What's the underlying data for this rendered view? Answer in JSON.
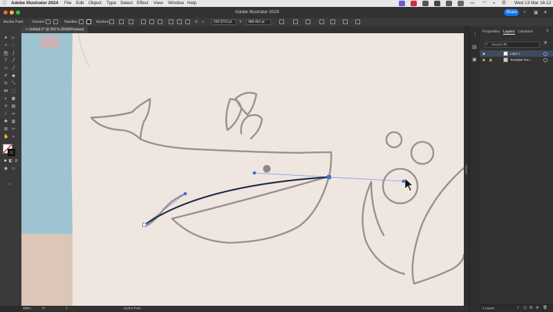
{
  "menubar": {
    "app_name": "Adobe Illustrator 2024",
    "menus": [
      "File",
      "Edit",
      "Object",
      "Type",
      "Select",
      "Effect",
      "View",
      "Window",
      "Help"
    ],
    "clock": "Wed 13 Mar  16:12"
  },
  "titlebar": {
    "title": "Adobe Illustrator 2024",
    "share_label": "Share"
  },
  "controlbar": {
    "anchor_point_label": "Anchor Point",
    "convert_label": "Convert:",
    "handles_label": "Handles:",
    "anchors_label": "Anchors:",
    "x_value": "530.9753 pt",
    "y_value": "488.463 pt"
  },
  "document_tab": {
    "title": "Untitled-2* @ 300 % (RGB/Preview)",
    "close": "×"
  },
  "statusbar": {
    "zoom": "300%",
    "rotation": "0°",
    "page": "1",
    "tool_name": "Anchor Point"
  },
  "panel": {
    "tabs": [
      "Properties",
      "Layers",
      "Libraries"
    ],
    "active_tab": "Layers",
    "search_placeholder": "Search All",
    "layers": [
      {
        "name": "Layer 1",
        "selected": true
      },
      {
        "name": "Template Pen...",
        "selected": false
      }
    ],
    "footer_count": "2 Layers"
  },
  "colors": {
    "accent": "#1473e6",
    "path_stroke": "#1f2a44",
    "sketch_line": "#9a9090",
    "anchor": "#3f6fe0",
    "paper": "#efe5df"
  },
  "icons": [
    "apple-icon",
    "wifi-icon",
    "battery-icon",
    "search-icon",
    "control-center-icon",
    "selection-tool-icon",
    "direct-selection-icon",
    "pen-tool-icon",
    "type-tool-icon",
    "rectangle-tool-icon",
    "eyedropper-icon",
    "hand-icon",
    "zoom-icon",
    "eye-icon",
    "lock-icon",
    "filter-icon",
    "close-icon"
  ]
}
